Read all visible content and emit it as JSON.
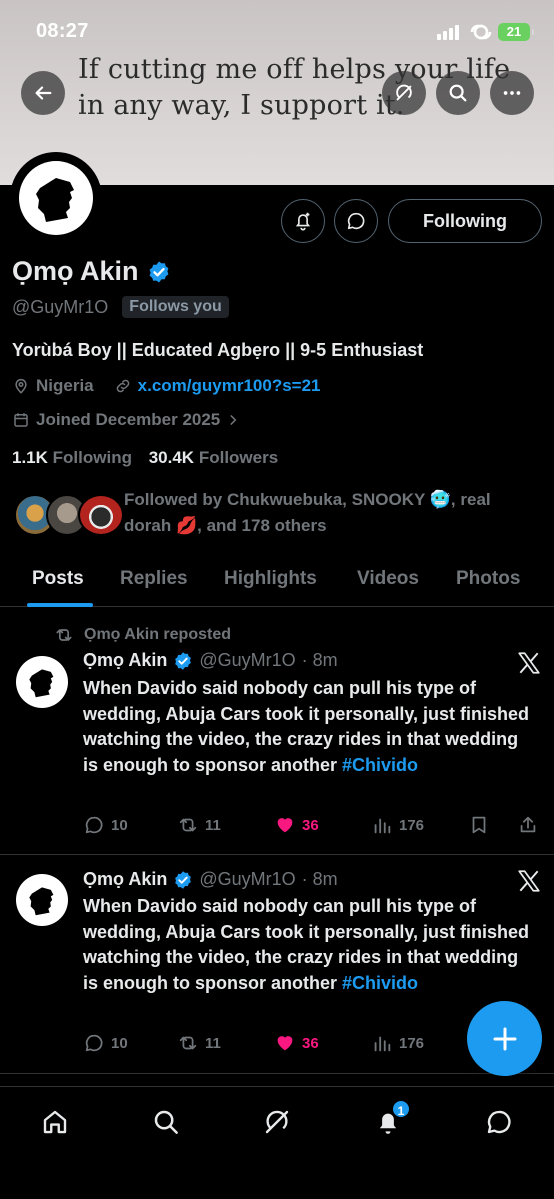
{
  "status_bar": {
    "time": "08:27",
    "battery": "21"
  },
  "banner": {
    "quote": "If cutting me off helps your life in any way, I support it."
  },
  "header_buttons": {
    "back_icon": "arrow-left-icon",
    "grok_icon": "grok-icon",
    "search_icon": "search-icon",
    "more_icon": "more-icon"
  },
  "profile": {
    "name": "Ọmọ Akin",
    "handle": "@GuyMr1O",
    "follows_you": "Follows you",
    "follow_button": "Following",
    "bio": "Yorùbá Boy || Educated Agbẹro || 9-5 Enthusiast",
    "location": "Nigeria",
    "website": "x.com/guymr100?s=21",
    "joined": "Joined December 2025",
    "following_count": "1.1K",
    "following_label": "Following",
    "followers_count": "30.4K",
    "followers_label": "Followers",
    "followed_by_1": "Followed by Chukwuebuka, SNOOKY",
    "followed_by_2": ", real",
    "followed_by_3": "dorah",
    "followed_by_4": ", and 178 others",
    "emoji_1": "🥶",
    "emoji_2": "💋"
  },
  "tabs": [
    "Posts",
    "Replies",
    "Highlights",
    "Videos",
    "Photos"
  ],
  "tweets": [
    {
      "repost_label": "Ọmọ Akin reposted",
      "name": "Ọmọ Akin",
      "handle": "@GuyMr1O",
      "time": "· 8m",
      "text": "When Davido said nobody can pull his type of wedding, Abuja Cars took it personally, just finished watching the video, the crazy rides in that wedding is enough to sponsor another",
      "hashtag": "#Chivido",
      "replies": "10",
      "reposts": "11",
      "likes": "36",
      "views": "176"
    },
    {
      "name": "Ọmọ Akin",
      "handle": "@GuyMr1O",
      "time": "· 8m",
      "text": "When Davido said nobody can pull his type of wedding, Abuja Cars took it personally, just finished watching the video, the crazy rides in that wedding is enough to sponsor another",
      "hashtag": "#Chivido",
      "replies": "10",
      "reposts": "11",
      "likes": "36",
      "views": "176"
    }
  ],
  "bottom_nav": {
    "notifications_badge": "1"
  },
  "colors": {
    "accent": "#1d9bf0",
    "like": "#f91880",
    "muted": "#71767b"
  }
}
